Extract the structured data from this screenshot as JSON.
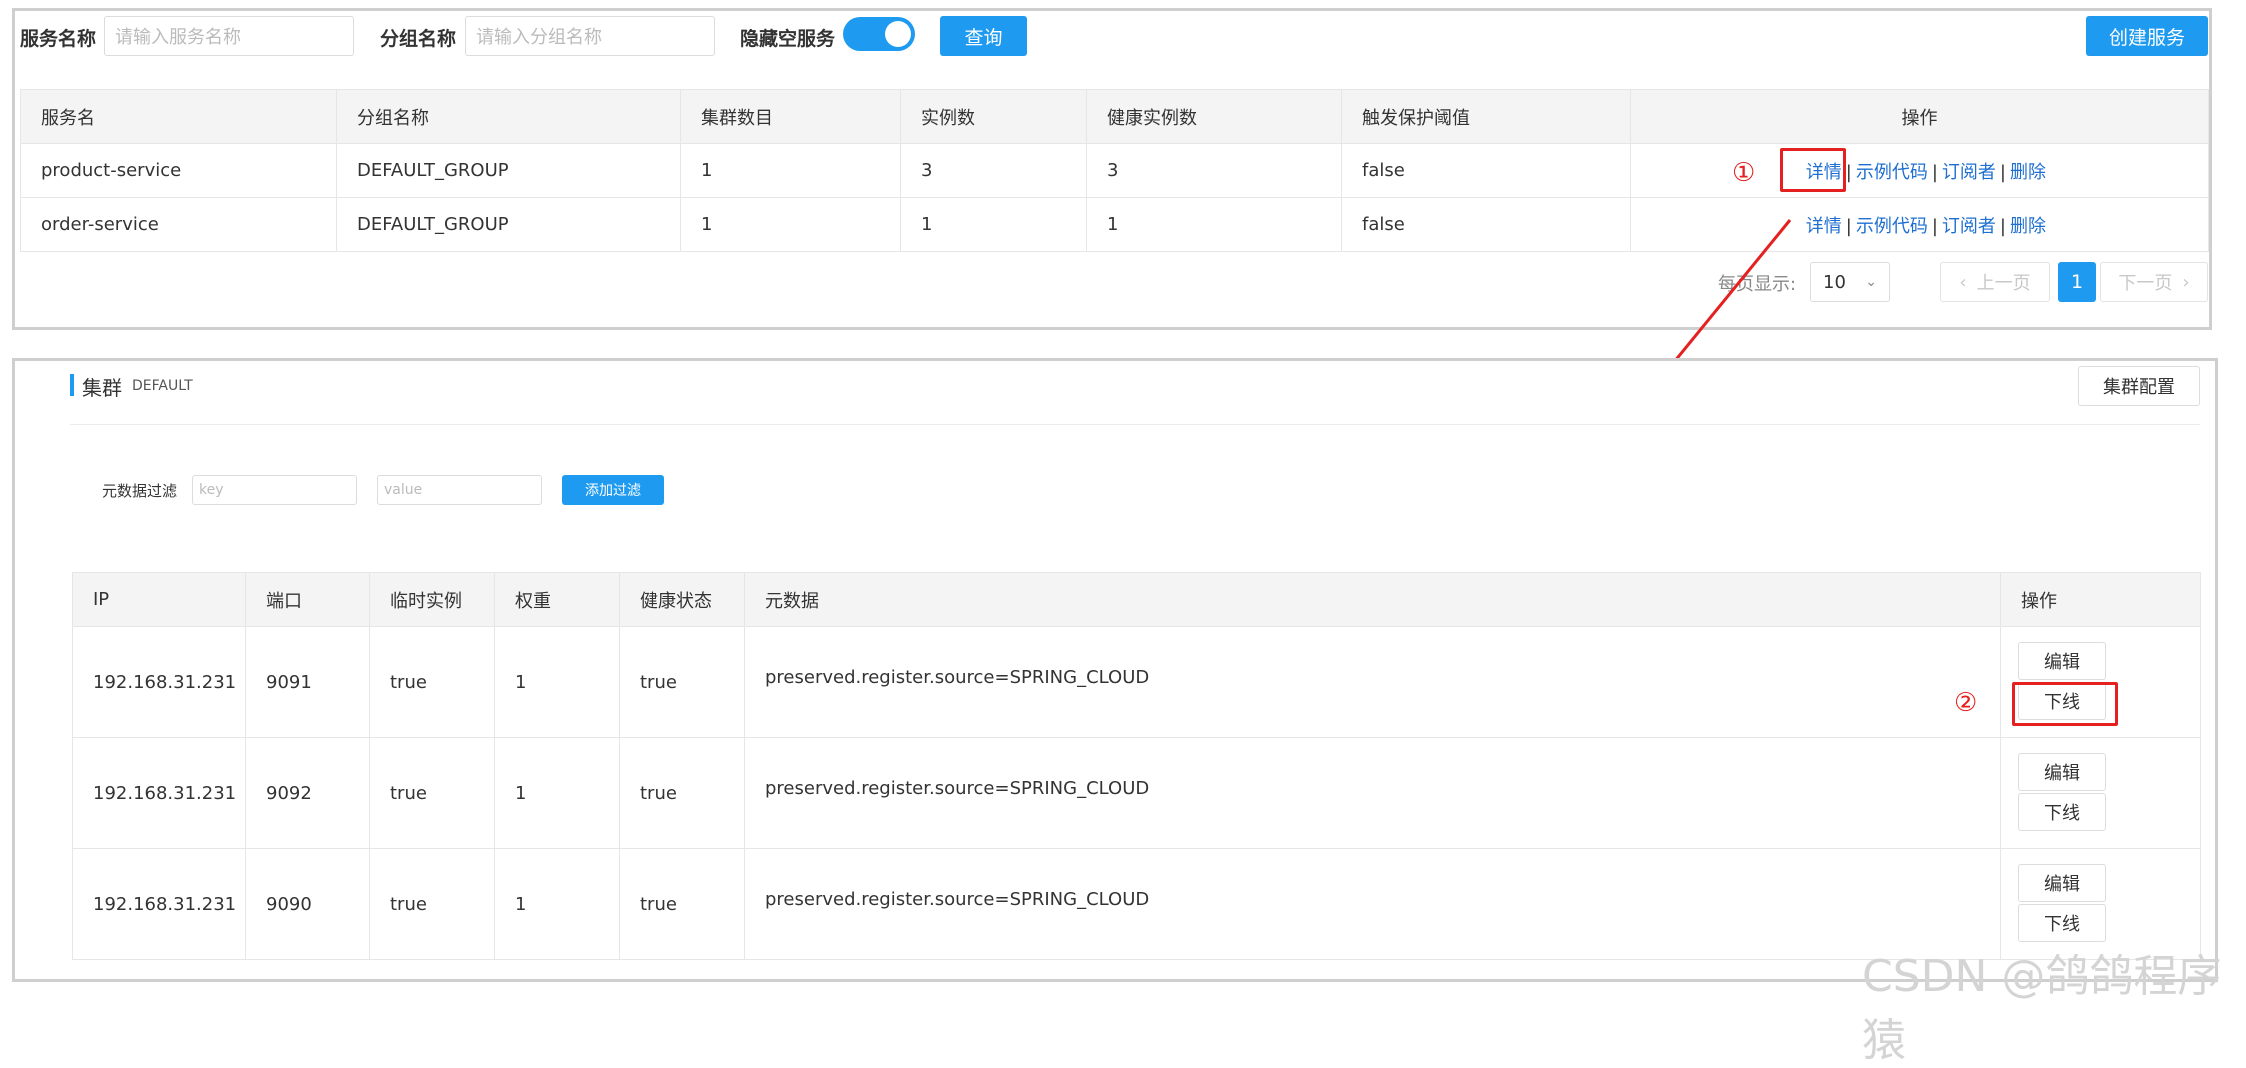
{
  "filter": {
    "service_name_label": "服务名称",
    "service_name_placeholder": "请输入服务名称",
    "group_name_label": "分组名称",
    "group_name_placeholder": "请输入分组名称",
    "hide_empty_label": "隐藏空服务",
    "query_button": "查询",
    "create_button": "创建服务"
  },
  "service_table": {
    "columns": [
      "服务名",
      "分组名称",
      "集群数目",
      "实例数",
      "健康实例数",
      "触发保护阈值",
      "操作"
    ],
    "rows": [
      {
        "name": "product-service",
        "group": "DEFAULT_GROUP",
        "clusters": "1",
        "instances": "3",
        "healthy": "3",
        "threshold": "false"
      },
      {
        "name": "order-service",
        "group": "DEFAULT_GROUP",
        "clusters": "1",
        "instances": "1",
        "healthy": "1",
        "threshold": "false"
      }
    ],
    "actions": {
      "detail": "详情",
      "sample": "示例代码",
      "subscriber": "订阅者",
      "delete": "删除",
      "sep": "|"
    }
  },
  "pagination": {
    "page_size_label": "每页显示:",
    "page_size": "10",
    "prev": "上一页",
    "current": "1",
    "next": "下一页"
  },
  "cluster": {
    "title": "集群",
    "name": "DEFAULT",
    "config_button": "集群配置",
    "meta_filter_label": "元数据过滤",
    "key_placeholder": "key",
    "value_placeholder": "value",
    "add_filter_button": "添加过滤"
  },
  "instance_table": {
    "columns": [
      "IP",
      "端口",
      "临时实例",
      "权重",
      "健康状态",
      "元数据",
      "操作"
    ],
    "rows": [
      {
        "ip": "192.168.31.231",
        "port": "9091",
        "ephemeral": "true",
        "weight": "1",
        "healthy": "true",
        "metadata": "preserved.register.source=SPRING_CLOUD"
      },
      {
        "ip": "192.168.31.231",
        "port": "9092",
        "ephemeral": "true",
        "weight": "1",
        "healthy": "true",
        "metadata": "preserved.register.source=SPRING_CLOUD"
      },
      {
        "ip": "192.168.31.231",
        "port": "9090",
        "ephemeral": "true",
        "weight": "1",
        "healthy": "true",
        "metadata": "preserved.register.source=SPRING_CLOUD"
      }
    ],
    "actions": {
      "edit": "编辑",
      "offline": "下线"
    }
  },
  "annotations": {
    "step1": "①",
    "step2": "②"
  },
  "watermark": "CSDN @鸽鸽程序猿",
  "colors": {
    "primary": "#1e9bf0",
    "link": "#1e6fd0",
    "annotation": "#e52020"
  }
}
